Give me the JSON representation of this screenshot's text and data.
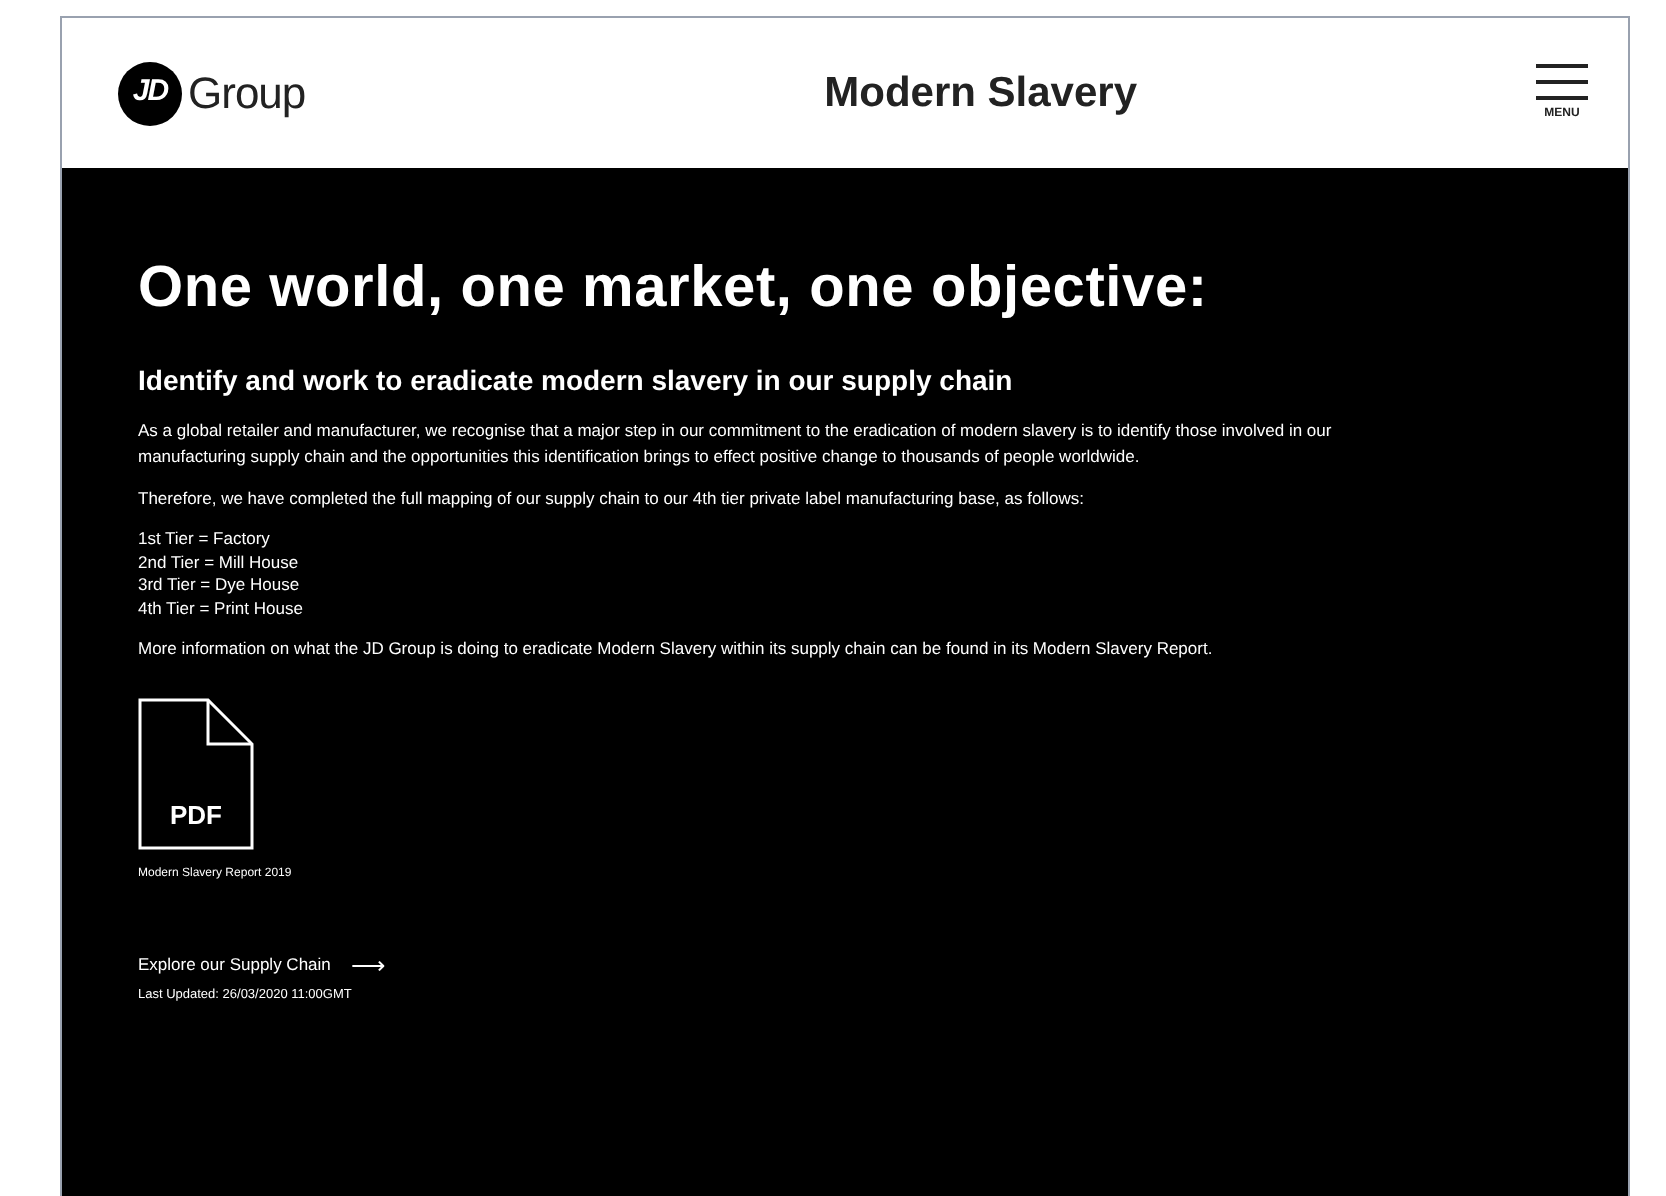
{
  "header": {
    "logo_mark": "JD",
    "logo_text": "Group",
    "title": "Modern Slavery",
    "menu_label": "MENU"
  },
  "main": {
    "heading": "One world, one market, one objective:",
    "subheading": "Identify and work to eradicate modern slavery in our supply chain",
    "paragraphs": [
      "As a global retailer and manufacturer, we recognise that a major step in our commitment to the eradication of modern slavery is to identify those involved in our manufacturing supply chain and the opportunities this identification brings to effect positive change to thousands of people worldwide.",
      "Therefore, we have completed the full mapping of our supply chain to our 4th tier private label manufacturing base, as follows:"
    ],
    "tiers": [
      "1st Tier = Factory",
      "2nd Tier = Mill House",
      "3rd Tier = Dye House",
      "4th Tier = Print House"
    ],
    "closing": "More information on what the JD Group is doing to eradicate Modern Slavery within its supply chain can be found in its Modern Slavery Report.",
    "document": {
      "icon_label": "PDF",
      "caption": "Modern Slavery Report 2019"
    },
    "link": {
      "label": "Explore our Supply Chain",
      "arrow": "⟶"
    },
    "updated": "Last Updated: 26/03/2020 11:00GMT"
  }
}
